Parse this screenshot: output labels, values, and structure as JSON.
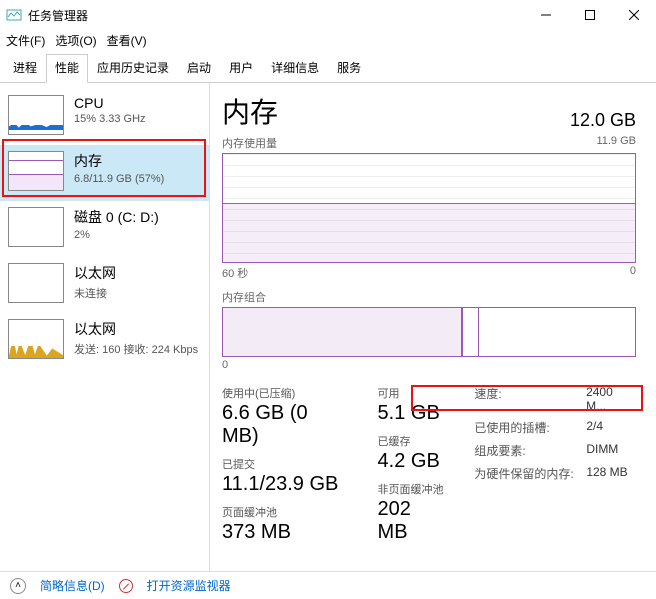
{
  "window": {
    "title": "任务管理器"
  },
  "menu": {
    "file": "文件(F)",
    "options": "选项(O)",
    "view": "查看(V)"
  },
  "tabs": [
    "进程",
    "性能",
    "应用历史记录",
    "启动",
    "用户",
    "详细信息",
    "服务"
  ],
  "active_tab": 1,
  "sidebar": [
    {
      "name": "CPU",
      "sub": "15% 3.33 GHz"
    },
    {
      "name": "内存",
      "sub": "6.8/11.9 GB (57%)"
    },
    {
      "name": "磁盘 0 (C: D:)",
      "sub": "2%"
    },
    {
      "name": "以太网",
      "sub": "未连接"
    },
    {
      "name": "以太网",
      "sub": "发送: 160 接收: 224 Kbps"
    }
  ],
  "detail": {
    "title": "内存",
    "total": "12.0 GB",
    "graph1_label": "内存使用量",
    "graph1_max": "11.9 GB",
    "graph1_xleft": "60 秒",
    "graph1_xright": "0",
    "graph2_label": "内存组合",
    "stats": {
      "in_use_label": "使用中(已压缩)",
      "in_use": "6.6 GB (0 MB)",
      "avail_label": "可用",
      "avail": "5.1 GB",
      "committed_label": "已提交",
      "committed": "11.1/23.9 GB",
      "cached_label": "已缓存",
      "cached": "4.2 GB",
      "paged_label": "页面缓冲池",
      "paged": "373 MB",
      "nonpaged_label": "非页面缓冲池",
      "nonpaged": "202 MB"
    },
    "info": {
      "speed_k": "速度:",
      "speed_v": "2400 M...",
      "slots_k": "已使用的插槽:",
      "slots_v": "2/4",
      "form_k": "组成要素:",
      "form_v": "DIMM",
      "reserved_k": "为硬件保留的内存:",
      "reserved_v": "128 MB"
    }
  },
  "footer": {
    "fewer": "简略信息(D)",
    "resmon": "打开资源监视器"
  }
}
